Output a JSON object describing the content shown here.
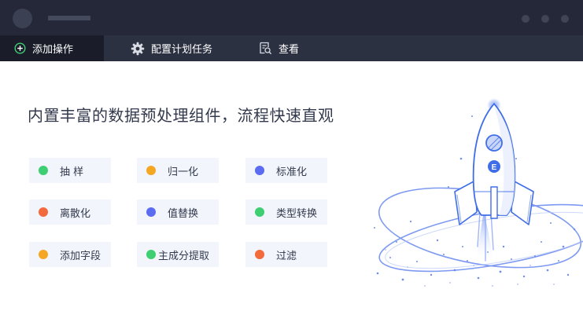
{
  "tabs": [
    {
      "label": "添加操作",
      "icon": "plus-circle-icon",
      "active": true
    },
    {
      "label": "配置计划任务",
      "icon": "gear-icon",
      "active": false
    },
    {
      "label": "查看",
      "icon": "document-search-icon",
      "active": false
    }
  ],
  "main": {
    "headline": "内置丰富的数据预处理组件，流程快速直观",
    "operations": [
      {
        "label": "抽 样",
        "color": "#3ecf72"
      },
      {
        "label": "归一化",
        "color": "#f5a623"
      },
      {
        "label": "标准化",
        "color": "#5b6cf0"
      },
      {
        "label": "离散化",
        "color": "#f36b3c"
      },
      {
        "label": "值替换",
        "color": "#5b6cf0"
      },
      {
        "label": "类型转换",
        "color": "#3ecf72"
      },
      {
        "label": "添加字段",
        "color": "#f5a623"
      },
      {
        "label": "主成分提取",
        "color": "#3ecf72"
      },
      {
        "label": "过滤",
        "color": "#f36b3c"
      }
    ]
  },
  "illustration": {
    "badge_letter": "E"
  },
  "colors": {
    "titlebar_bg": "#242838",
    "tabbar_bg": "#2c3142",
    "active_tab_bg": "#1a1d29",
    "chip_bg": "#f2f6fc",
    "accent_blue": "#3f6ee8"
  }
}
